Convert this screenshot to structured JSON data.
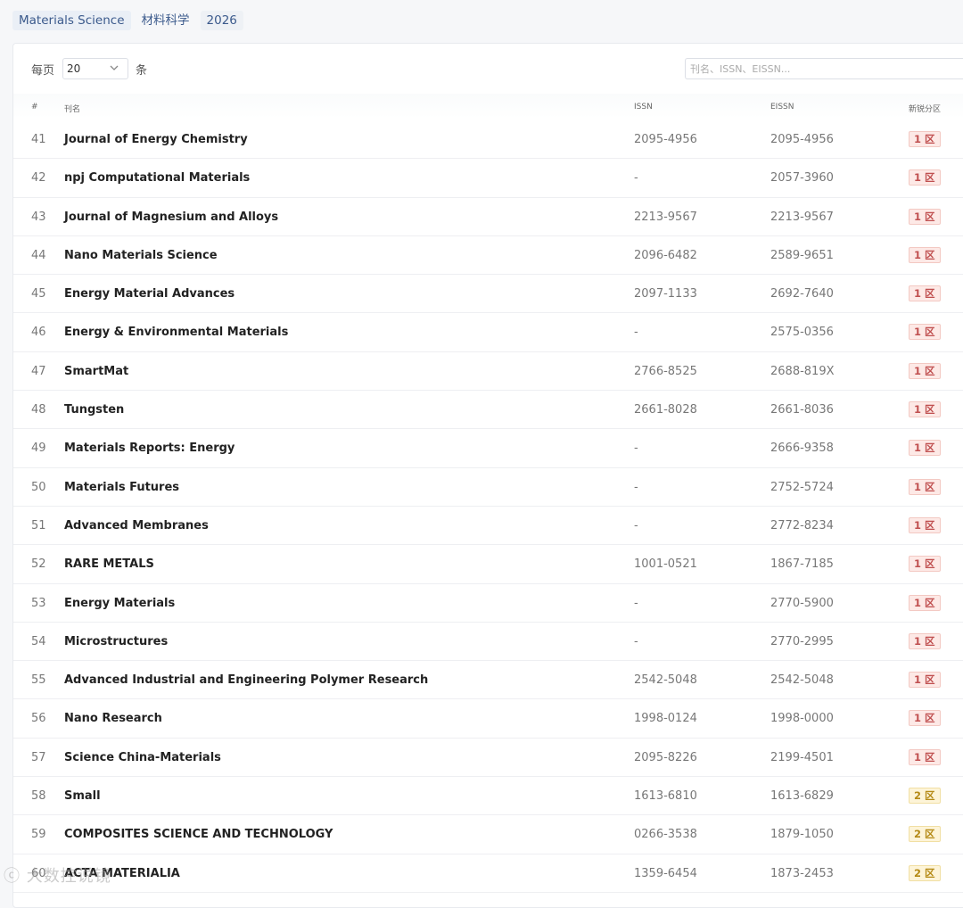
{
  "tags": {
    "field_en": "Materials Science",
    "field_cn": "材料科学",
    "year": "2026"
  },
  "toolbar": {
    "per_page_label": "每页",
    "per_page_value": "20",
    "per_page_unit": "条",
    "search_placeholder": "刊名、ISSN、EISSN..."
  },
  "table": {
    "columns": {
      "index": "#",
      "name": "刊名",
      "issn": "ISSN",
      "eissn": "EISSN",
      "zone": "新锐分区"
    },
    "rows": [
      {
        "index": "41",
        "name": "Journal of Energy Chemistry",
        "issn": "2095-4956",
        "eissn": "2095-4956",
        "zone": "1 区",
        "tier": 1
      },
      {
        "index": "42",
        "name": "npj Computational Materials",
        "issn": "-",
        "eissn": "2057-3960",
        "zone": "1 区",
        "tier": 1
      },
      {
        "index": "43",
        "name": "Journal of Magnesium and Alloys",
        "issn": "2213-9567",
        "eissn": "2213-9567",
        "zone": "1 区",
        "tier": 1
      },
      {
        "index": "44",
        "name": "Nano Materials Science",
        "issn": "2096-6482",
        "eissn": "2589-9651",
        "zone": "1 区",
        "tier": 1
      },
      {
        "index": "45",
        "name": "Energy Material Advances",
        "issn": "2097-1133",
        "eissn": "2692-7640",
        "zone": "1 区",
        "tier": 1
      },
      {
        "index": "46",
        "name": "Energy & Environmental Materials",
        "issn": "-",
        "eissn": "2575-0356",
        "zone": "1 区",
        "tier": 1
      },
      {
        "index": "47",
        "name": "SmartMat",
        "issn": "2766-8525",
        "eissn": "2688-819X",
        "zone": "1 区",
        "tier": 1
      },
      {
        "index": "48",
        "name": "Tungsten",
        "issn": "2661-8028",
        "eissn": "2661-8036",
        "zone": "1 区",
        "tier": 1
      },
      {
        "index": "49",
        "name": "Materials Reports: Energy",
        "issn": "-",
        "eissn": "2666-9358",
        "zone": "1 区",
        "tier": 1
      },
      {
        "index": "50",
        "name": "Materials Futures",
        "issn": "-",
        "eissn": "2752-5724",
        "zone": "1 区",
        "tier": 1
      },
      {
        "index": "51",
        "name": "Advanced Membranes",
        "issn": "-",
        "eissn": "2772-8234",
        "zone": "1 区",
        "tier": 1
      },
      {
        "index": "52",
        "name": "RARE METALS",
        "issn": "1001-0521",
        "eissn": "1867-7185",
        "zone": "1 区",
        "tier": 1
      },
      {
        "index": "53",
        "name": "Energy Materials",
        "issn": "-",
        "eissn": "2770-5900",
        "zone": "1 区",
        "tier": 1
      },
      {
        "index": "54",
        "name": "Microstructures",
        "issn": "-",
        "eissn": "2770-2995",
        "zone": "1 区",
        "tier": 1
      },
      {
        "index": "55",
        "name": "Advanced Industrial and Engineering Polymer Research",
        "issn": "2542-5048",
        "eissn": "2542-5048",
        "zone": "1 区",
        "tier": 1
      },
      {
        "index": "56",
        "name": "Nano Research",
        "issn": "1998-0124",
        "eissn": "1998-0000",
        "zone": "1 区",
        "tier": 1
      },
      {
        "index": "57",
        "name": "Science China-Materials",
        "issn": "2095-8226",
        "eissn": "2199-4501",
        "zone": "1 区",
        "tier": 1
      },
      {
        "index": "58",
        "name": "Small",
        "issn": "1613-6810",
        "eissn": "1613-6829",
        "zone": "2 区",
        "tier": 2
      },
      {
        "index": "59",
        "name": "COMPOSITES SCIENCE AND TECHNOLOGY",
        "issn": "0266-3538",
        "eissn": "1879-1050",
        "zone": "2 区",
        "tier": 2
      },
      {
        "index": "60",
        "name": "ACTA MATERIALIA",
        "issn": "1359-6454",
        "eissn": "1873-2453",
        "zone": "2 区",
        "tier": 2
      }
    ]
  },
  "watermark": "ⓒ 大数控说镜"
}
